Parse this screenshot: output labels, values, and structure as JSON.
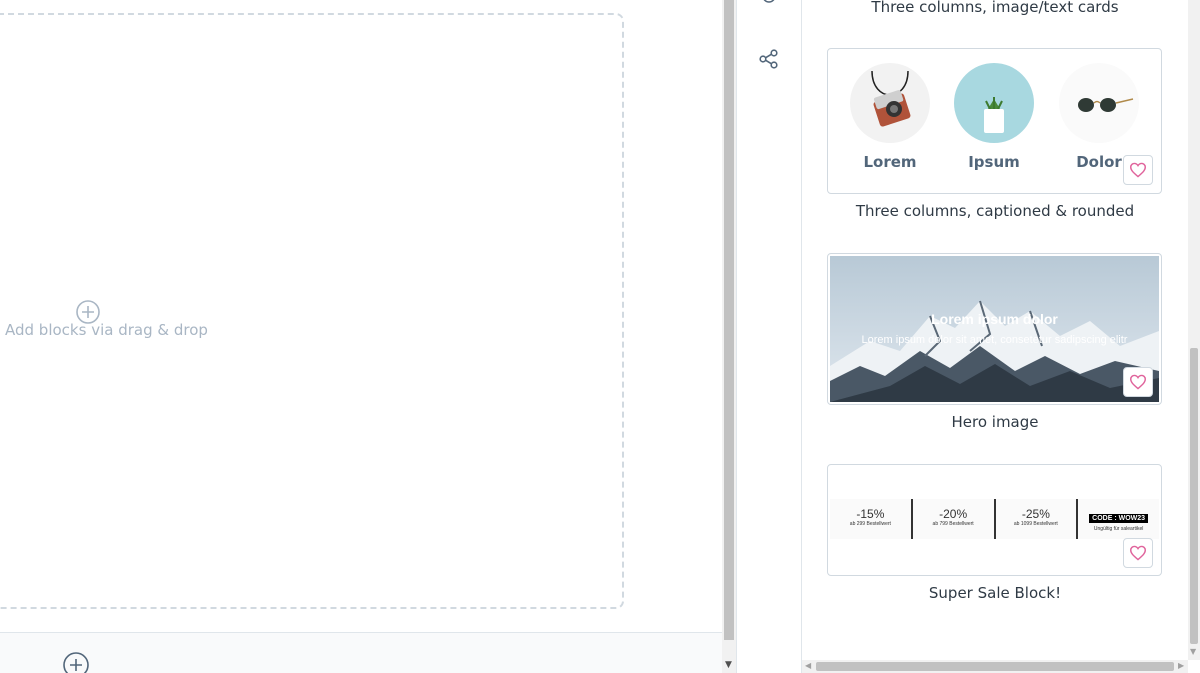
{
  "canvas": {
    "drop_hint": "Add blocks via drag & drop",
    "add_section_icon": "plus-circle-icon"
  },
  "sidebar_rail": {
    "icons": [
      "partial-icon",
      "share-icon"
    ]
  },
  "blocks_panel": {
    "prev_caption": "Three columns, image/text cards",
    "items": [
      {
        "caption": "Three columns, captioned & rounded",
        "columns": [
          {
            "label": "Lorem",
            "image": "camera"
          },
          {
            "label": "Ipsum",
            "image": "plant"
          },
          {
            "label": "Dolor",
            "image": "sunglasses"
          }
        ],
        "fav_icon": "heart-icon"
      },
      {
        "caption": "Hero image",
        "hero_title": "Lorem ipsum dolor",
        "hero_subtitle": "Lorem ipsum dolor sit amet, consetetur sadipscing elitr",
        "fav_icon": "heart-icon"
      },
      {
        "caption": "Super Sale Block!",
        "sale_cells": [
          {
            "pct": "-15%",
            "sub": "ab 299 Bestellwert"
          },
          {
            "pct": "-20%",
            "sub": "ab 799 Bestellwert"
          },
          {
            "pct": "-25%",
            "sub": "ab 1099 Bestellwert"
          }
        ],
        "code_label": "CODE : WOW23",
        "code_sub": "Ungültig für saleartikel",
        "fav_icon": "heart-icon"
      }
    ]
  },
  "colors": {
    "heart": "#e0649c",
    "border": "#d1d9e0",
    "muted": "#a9b6c4"
  }
}
